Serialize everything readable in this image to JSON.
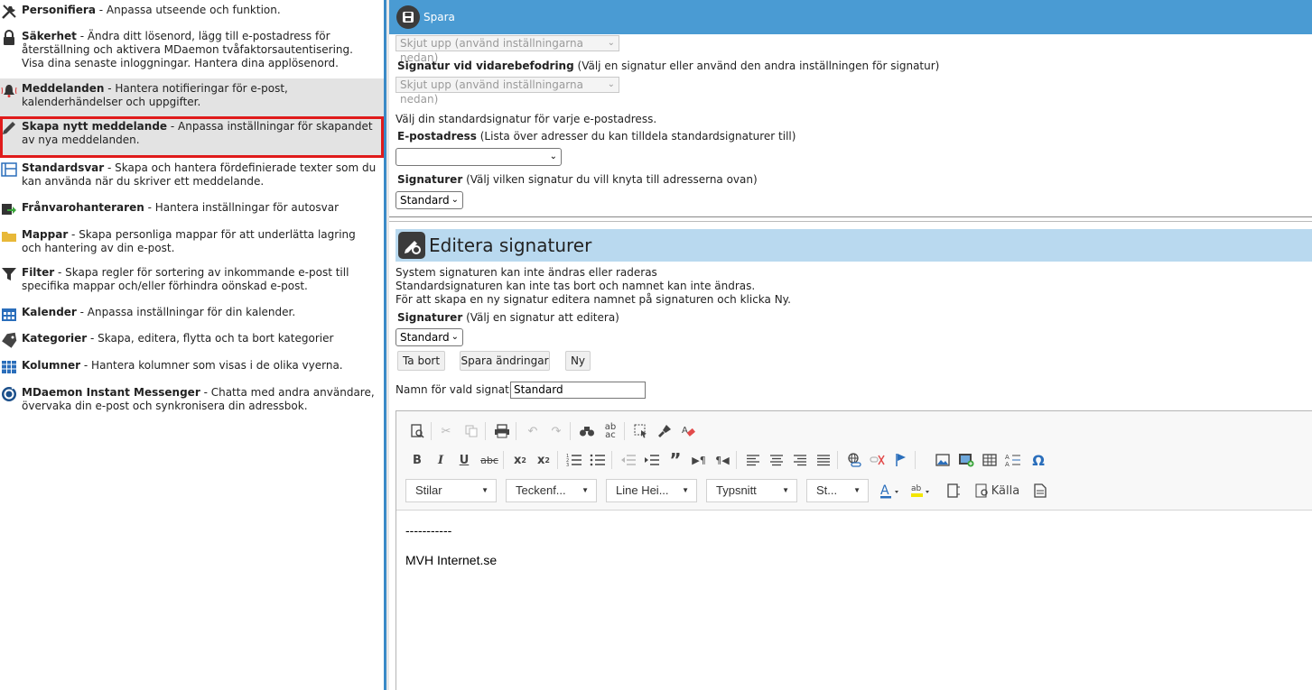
{
  "left_menu": [
    {
      "title": "Personifiera",
      "desc": " - Anpassa utseende och funktion.",
      "icon": "tools-icon"
    },
    {
      "title": "Säkerhet",
      "desc": " - Ändra ditt lösenord, lägg till e-postadress för återställning och aktivera MDaemon tvåfaktorsautentisering. Visa dina senaste inloggningar. Hantera dina applösenord.",
      "icon": "lock-icon"
    },
    {
      "title": "Meddelanden",
      "desc": " - Hantera notifieringar för e-post, kalenderhändelser och uppgifter.",
      "icon": "bell-icon"
    },
    {
      "title": "Skapa nytt meddelande",
      "desc": " - Anpassa inställningar för skapandet av nya meddelanden.",
      "icon": "pencil-icon"
    },
    {
      "title": "Standardsvar",
      "desc": " - Skapa och hantera fördefinierade texter som du kan använda när du skriver ett meddelande.",
      "icon": "template-icon"
    },
    {
      "title": "Frånvarohanteraren",
      "desc": " - Hantera inställningar för autosvar",
      "icon": "autoreply-icon"
    },
    {
      "title": "Mappar",
      "desc": " - Skapa personliga mappar för att underlätta lagring och hantering av din e-post.",
      "icon": "folder-icon"
    },
    {
      "title": "Filter",
      "desc": " - Skapa regler för sortering av inkommande e-post till specifika mappar och/eller förhindra oönskad e-post.",
      "icon": "filter-icon"
    },
    {
      "title": "Kalender",
      "desc": " - Anpassa inställningar för din kalender.",
      "icon": "calendar-icon"
    },
    {
      "title": "Kategorier",
      "desc": " - Skapa, editera, flytta och ta bort kategorier",
      "icon": "tag-icon"
    },
    {
      "title": "Kolumner",
      "desc": " - Hantera kolumner som visas i de olika vyerna.",
      "icon": "columns-icon"
    },
    {
      "title": "MDaemon Instant Messenger",
      "desc": " - Chatta med andra användare, övervaka din e-post och synkronisera din adressbok.",
      "icon": "messenger-icon"
    }
  ],
  "topbar": {
    "save_label": "Spara"
  },
  "forward_signature": {
    "first_select": "Skjut upp (använd inställningarna nedan)",
    "label": "Signatur vid vidarebefodring",
    "hint": " (Välj en signatur eller använd den andra inställningen för signatur)",
    "select": "Skjut upp (använd inställningarna nedan)"
  },
  "default_signature": {
    "intro": "Välj din standardsignatur för varje e-postadress.",
    "email_label": "E-postadress",
    "email_hint": " (Lista över adresser du kan tilldela standardsignaturer till)",
    "email_value": "",
    "sig_label": "Signaturer",
    "sig_hint": " (Välj vilken signatur du vill knyta till adresserna ovan)",
    "sig_value": "Standard"
  },
  "edit": {
    "title": "Editera signaturer",
    "info1": "System signaturen kan inte ändras eller raderas",
    "info2": "Standardsignaturen kan inte tas bort och namnet kan inte ändras.",
    "info3": "För att skapa en ny signatur editera namnet på signaturen och klicka Ny.",
    "sig_label": "Signaturer",
    "sig_hint": " (Välj en signatur att editera)",
    "sig_value": "Standard",
    "btn_delete": "Ta bort",
    "btn_save": "Spara ändringar",
    "btn_new": "Ny",
    "name_label": "Namn för vald signatur",
    "name_value": "Standard"
  },
  "editor": {
    "combos": [
      "Stilar",
      "Teckenf...",
      "Line Hei...",
      "Typsnitt",
      "St..."
    ],
    "source_label": "Källa",
    "content_line1": "-----------",
    "content_line2": "MVH Internet.se"
  },
  "colors": {
    "accent": "#4a9bd3",
    "header_bg": "#b9d9ef",
    "highlight": "#e01b1b"
  }
}
